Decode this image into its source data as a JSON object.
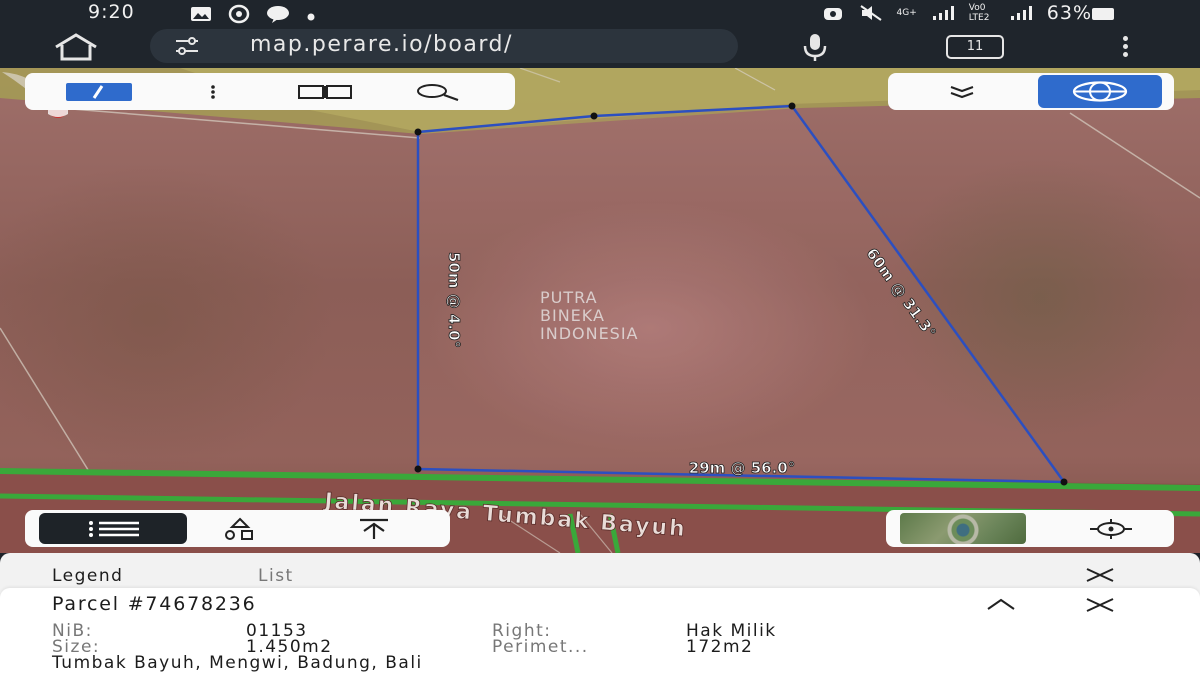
{
  "status_bar": {
    "time": "9:20",
    "left_icons": [
      "gallery-icon",
      "whatsapp-icon",
      "chat-icon",
      "dot-icon"
    ],
    "right_icons": [
      "alarm-icon",
      "mute-icon",
      "network-4g-icon",
      "signal-icon",
      "volte-icon",
      "signal-icon-2"
    ],
    "network_top": "4G+",
    "volte_label": "Vo0 LTE2",
    "battery": "63%"
  },
  "browser": {
    "url": "map.perare.io/board/",
    "tabs_count": "11"
  },
  "map": {
    "road_label": "Jalan Raya Tumbak Bayuh",
    "measurements": {
      "left_side": "50m @ 4.0°",
      "right_side": "60m @ 31.3°",
      "bottom_side": "29m @ 56.0°"
    },
    "watermark": [
      "PUTRA",
      "BINEKA",
      "INDONESIA"
    ]
  },
  "toolbars": {
    "top_left": [
      "edit-icon",
      "more-vert-icon",
      "book-icon",
      "search-icon"
    ],
    "top_right": [
      "expand-down-icon",
      "globe-icon"
    ],
    "bottom_left": [
      "list-icon",
      "shapes-icon",
      "upload-icon"
    ],
    "bottom_right": [
      "satellite-thumbnail",
      "locate-icon"
    ]
  },
  "panel": {
    "tabs": {
      "legend": "Legend",
      "list": "List"
    },
    "parcel_title": "Parcel #74678236",
    "fields": {
      "nib_label": "NiB:",
      "nib_value": "01153",
      "right_label": "Right:",
      "right_value": "Hak Milik",
      "size_label": "Size:",
      "size_value": "1.450m2",
      "perimeter_label": "Perimet...",
      "perimeter_value": "172m2"
    },
    "address": "Tumbak Bayuh, Mengwi, Badung, Bali"
  },
  "colors": {
    "accent_blue": "#2f6bcc",
    "parcel_line": "#2c4fc0",
    "road_green": "#3aa83a",
    "dark_bar": "#1f252c"
  }
}
